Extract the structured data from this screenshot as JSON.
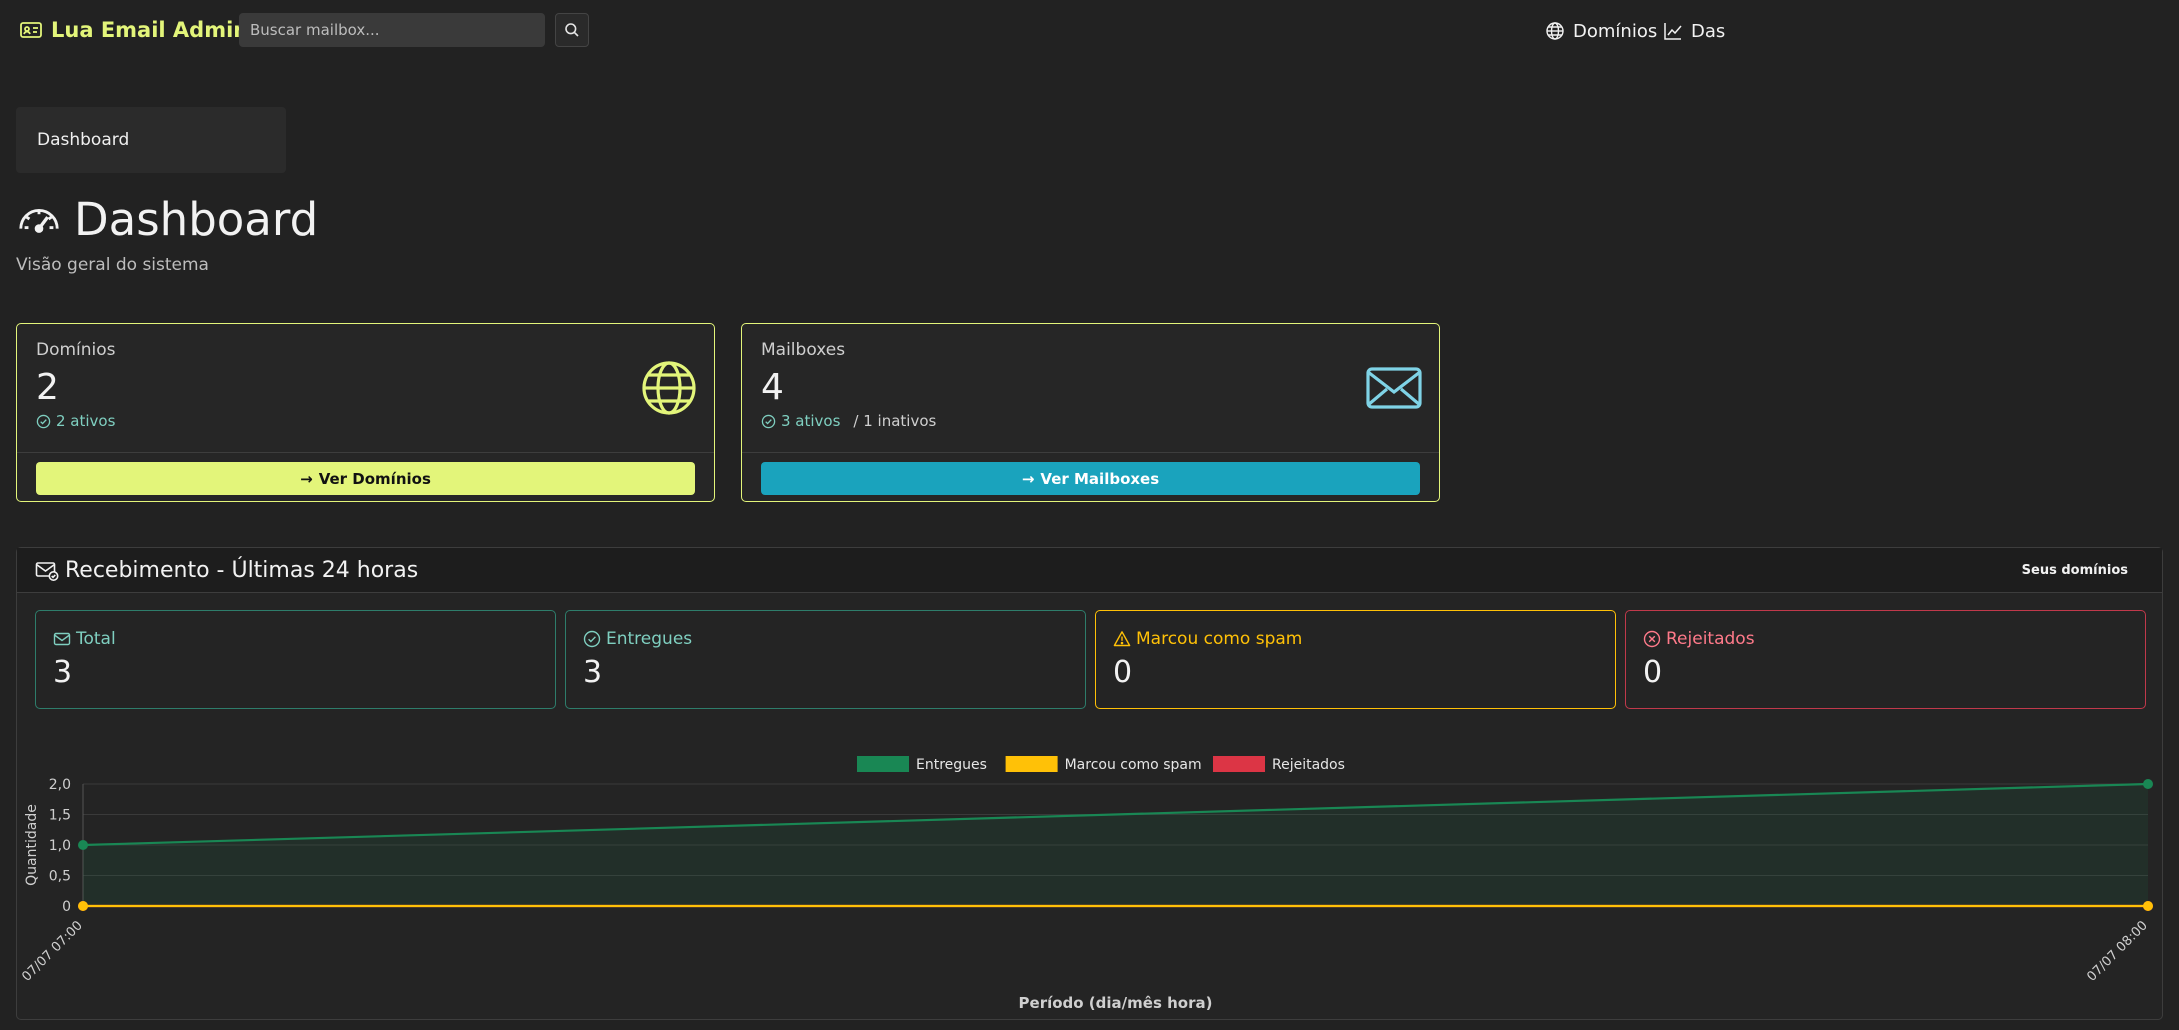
{
  "navbar": {
    "brand": "Lua Email Admin",
    "search_placeholder": "Buscar mailbox...",
    "links": [
      {
        "label": "Domínios",
        "icon": "globe-icon"
      },
      {
        "label": "Das",
        "icon": "chart-line-icon"
      }
    ]
  },
  "breadcrumb": {
    "current": "Dashboard"
  },
  "header": {
    "title": "Dashboard",
    "subtitle": "Visão geral do sistema"
  },
  "stats": {
    "domains": {
      "label": "Domínios",
      "value": "2",
      "active": "2 ativos",
      "button": "Ver Domínios",
      "icon": "globe-icon",
      "accent": "#e3f57a"
    },
    "mailboxes": {
      "label": "Mailboxes",
      "value": "4",
      "active": "3 ativos",
      "inactive": "/ 1 inativos",
      "button": "Ver Mailboxes",
      "icon": "envelope-icon",
      "accent": "#1aa3bd"
    }
  },
  "receiving": {
    "title": "Recebimento - Últimas 24 horas",
    "badge": "Seus domínios",
    "cards": [
      {
        "label": "Total",
        "value": "3",
        "color": "#7fcfc0"
      },
      {
        "label": "Entregues",
        "value": "3",
        "color": "#7fcfc0"
      },
      {
        "label": "Marcou como spam",
        "value": "0",
        "color": "#ffc107"
      },
      {
        "label": "Rejeitados",
        "value": "0",
        "color": "#ff7a8a"
      }
    ]
  },
  "chart_data": {
    "type": "line",
    "x": [
      "07/07 07:00",
      "07/07 08:00"
    ],
    "series": [
      {
        "name": "Entregues",
        "values": [
          1,
          2
        ],
        "color": "#198754"
      },
      {
        "name": "Marcou como spam",
        "values": [
          0,
          0
        ],
        "color": "#ffc107"
      },
      {
        "name": "Rejeitados",
        "values": [
          0,
          0
        ],
        "color": "#dc3545"
      }
    ],
    "ylim": [
      0,
      2
    ],
    "yticks": [
      "0",
      "0,5",
      "1,0",
      "1,5",
      "2,0"
    ],
    "xlabel": "Período (dia/mês hora)",
    "ylabel": "Quantidade",
    "legend": "top-center",
    "grid": true
  }
}
